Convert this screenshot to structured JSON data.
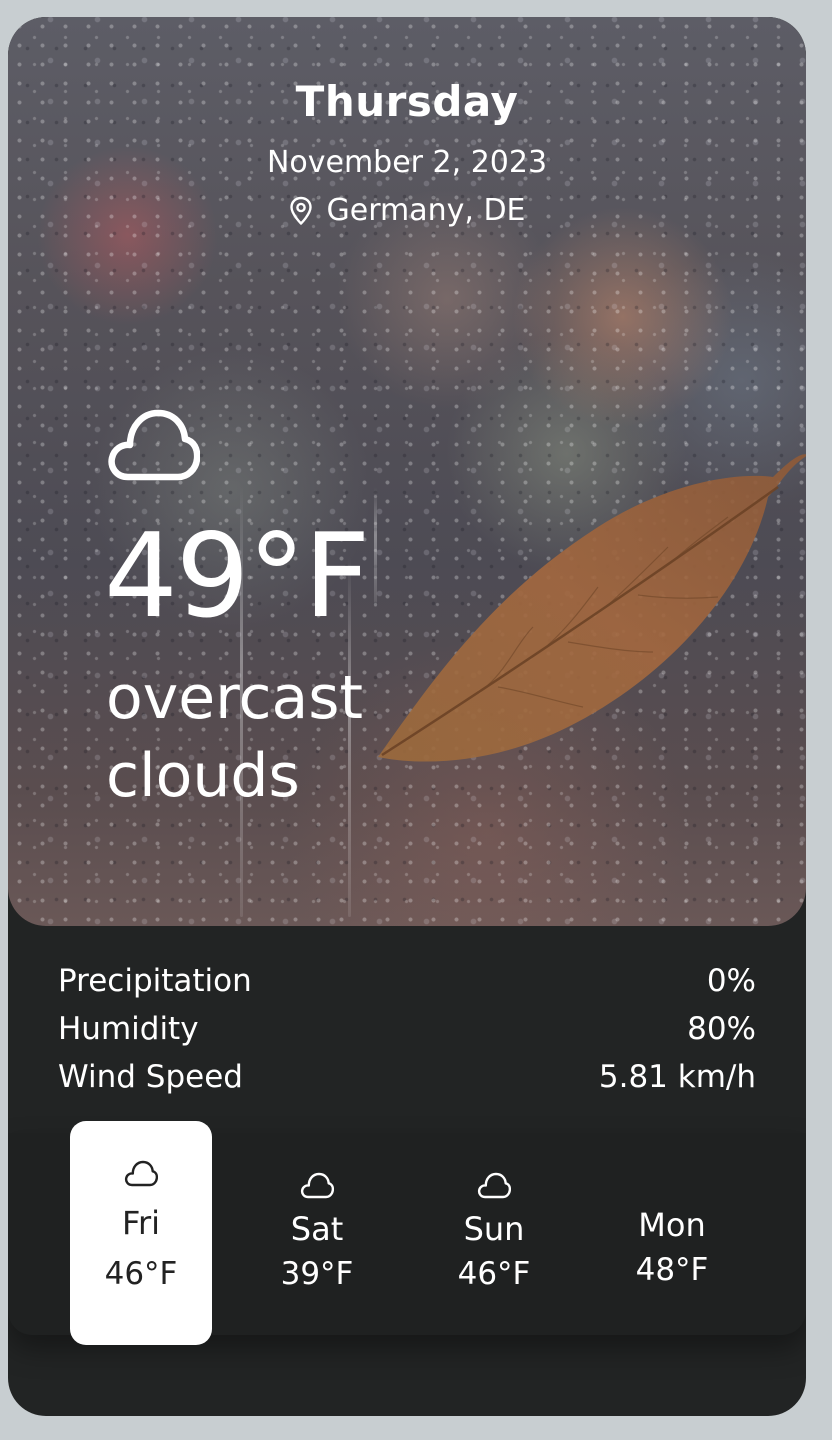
{
  "header": {
    "day": "Thursday",
    "date": "November 2, 2023",
    "location": "Germany, DE"
  },
  "current": {
    "icon": "cloud-icon",
    "temperature": "49°F",
    "description": "overcast clouds"
  },
  "stats": [
    {
      "label": "Precipitation",
      "value": "0%"
    },
    {
      "label": "Humidity",
      "value": "80%"
    },
    {
      "label": "Wind Speed",
      "value": "5.81 km/h"
    }
  ],
  "forecast": [
    {
      "day": "Fri",
      "temp": "46°F",
      "icon": "cloud-icon",
      "selected": true
    },
    {
      "day": "Sat",
      "temp": "39°F",
      "icon": "cloud-icon",
      "selected": false
    },
    {
      "day": "Sun",
      "temp": "46°F",
      "icon": "cloud-icon",
      "selected": false
    },
    {
      "day": "Mon",
      "temp": "48°F",
      "icon": "",
      "selected": false
    }
  ],
  "colors": {
    "page_background": "#c8ced1",
    "card_background": "#222424",
    "selected_day_background": "#ffffff"
  }
}
